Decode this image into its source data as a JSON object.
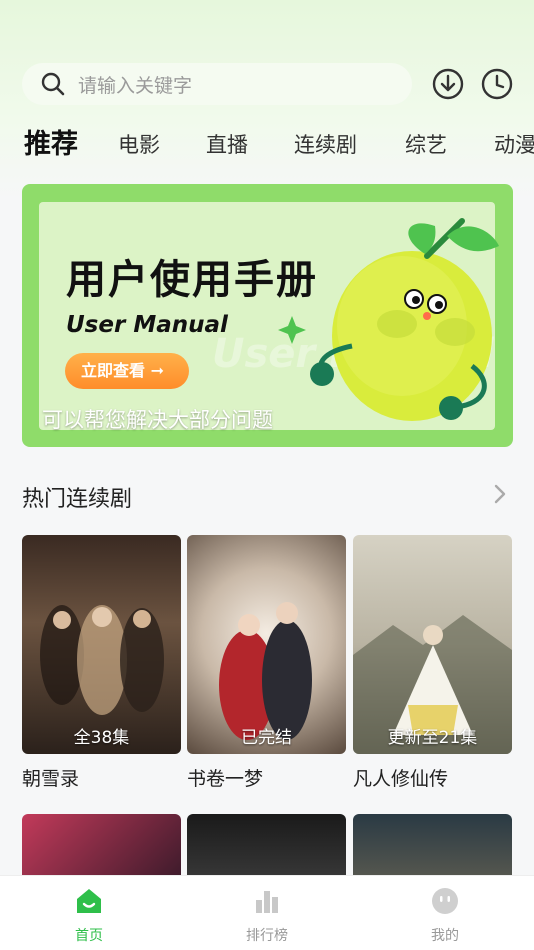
{
  "search": {
    "placeholder": "请输入关键字"
  },
  "icons": {
    "search": "search-icon",
    "download": "download-icon",
    "history": "clock-icon",
    "more": "chevron-right-icon"
  },
  "tabs": [
    {
      "label": "推荐",
      "active": true
    },
    {
      "label": "电影"
    },
    {
      "label": "直播"
    },
    {
      "label": "连续剧"
    },
    {
      "label": "综艺"
    },
    {
      "label": "动漫"
    }
  ],
  "banner": {
    "title": "用户使用手册",
    "subtitle": "User Manual",
    "watermark": "User Manual",
    "button": "立即查看 ➞",
    "caption": "可以帮您解决大部分问题"
  },
  "section": {
    "title": "热门连续剧"
  },
  "shows": [
    {
      "title": "朝雪录",
      "badge": "全38集"
    },
    {
      "title": "书卷一梦",
      "badge": "已完结"
    },
    {
      "title": "凡人修仙传",
      "badge": "更新至21集"
    }
  ],
  "nav": [
    {
      "label": "首页",
      "active": true
    },
    {
      "label": "排行榜"
    },
    {
      "label": "我的"
    }
  ],
  "colors": {
    "accent": "#2fbf4a",
    "banner": "#8fdc6a",
    "button": "#ff9a33"
  }
}
